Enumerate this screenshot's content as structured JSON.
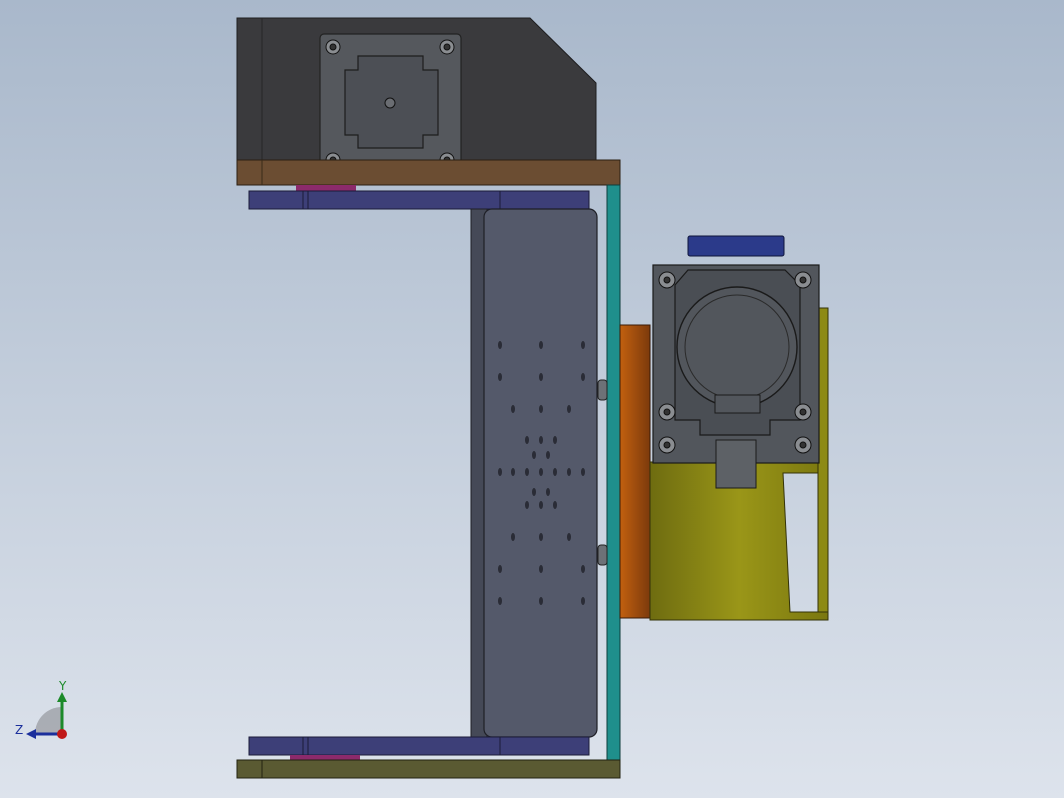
{
  "viewport": {
    "background_top": "#a9b8cb",
    "background_bottom": "#dde3ec"
  },
  "triad": {
    "y_label": "Y",
    "z_label": "Z",
    "y_color": "#1c8a2a",
    "z_color": "#1b2f9c",
    "origin_color": "#c01818"
  },
  "colors": {
    "dark_housing": "#3b3b3e",
    "brown_plate": "#6b4d32",
    "navy_rail": "#3d3f78",
    "gray_plate": "#54596a",
    "teal_plate": "#1f8f8c",
    "orange_block": "#b3520f",
    "olive_gear": "#8d8a14",
    "motor_gray": "#52565c",
    "blue_cap": "#2b3a8a",
    "magenta_part": "#8c2a6b",
    "olive_base": "#5a5a32"
  }
}
